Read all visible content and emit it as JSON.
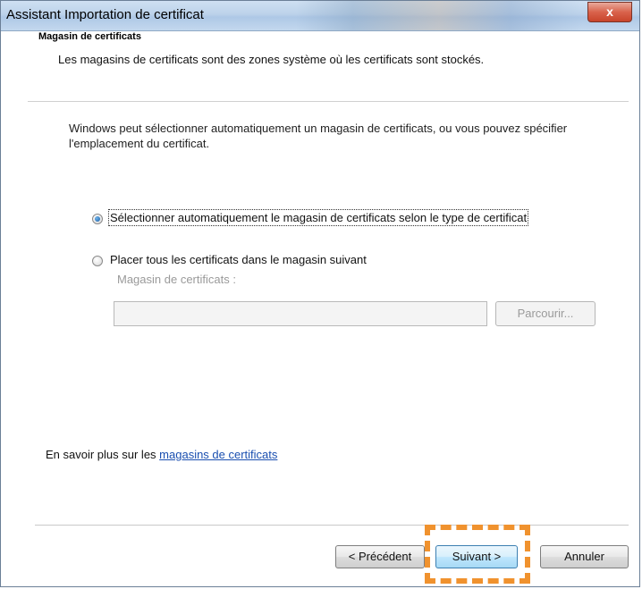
{
  "window": {
    "title": "Assistant Importation de certificat",
    "close_label": "x"
  },
  "header": {
    "title": "Magasin de certificats",
    "description": "Les magasins de certificats sont des zones système où les certificats sont stockés."
  },
  "body": {
    "intro": "Windows peut sélectionner automatiquement un magasin de certificats, ou vous pouvez spécifier l'emplacement du certificat.",
    "options": [
      {
        "label": "Sélectionner automatiquement le magasin de certificats selon le type de certificat",
        "selected": true
      },
      {
        "label": "Placer tous les certificats dans le magasin suivant",
        "selected": false
      }
    ],
    "store_label": "Magasin de certificats :",
    "store_value": "",
    "browse_label": "Parcourir...",
    "learn_prefix": "En savoir plus sur les ",
    "learn_link": "magasins de certificats"
  },
  "footer": {
    "back_label": "< Précédent",
    "next_label": "Suivant >",
    "cancel_label": "Annuler"
  },
  "colors": {
    "highlight": "#f0922e",
    "link": "#1a4fb0"
  }
}
